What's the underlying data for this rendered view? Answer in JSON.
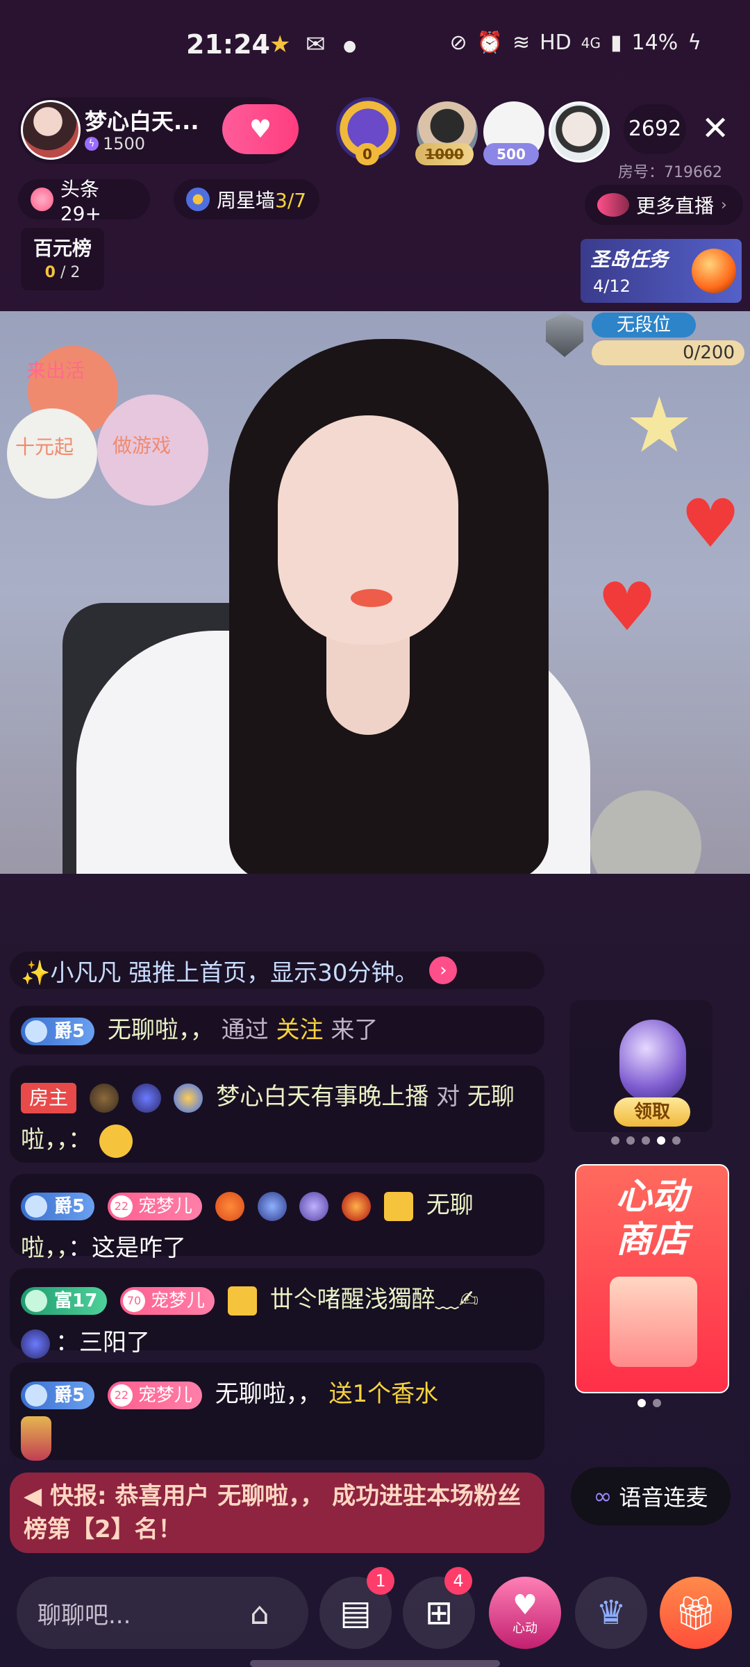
{
  "status_bar": {
    "time": "21:24",
    "network": "HD",
    "signal": "4G",
    "battery": "14%"
  },
  "host": {
    "name": "梦心白天...",
    "count": "1500",
    "follow_icon": "heart-plus"
  },
  "viewers": {
    "badge_1": "0",
    "badge_2": "1000",
    "badge_3": "500",
    "total": "2692",
    "room_id": "房号：719662"
  },
  "top_pills": {
    "headline": "头条29+",
    "weekstar_prefix": "周星墙",
    "weekstar_value": "3/7",
    "more_live": "更多直播"
  },
  "board": {
    "title": "百元榜",
    "current": "0",
    "total": "/ 2"
  },
  "task": {
    "title": "圣岛任务",
    "progress": "4/12"
  },
  "video": {
    "balloon_texts": [
      "来出活",
      "十元起",
      "做游戏"
    ]
  },
  "rank": {
    "label": "无段位",
    "progress": "0/200"
  },
  "pin_bar": {
    "text": "✨小凡凡 强推上首页，显示30分钟。"
  },
  "chat": {
    "m1": {
      "badge": "爵5",
      "user": "无聊啦，，",
      "pre": "通过",
      "action": "关注",
      "post": "来了"
    },
    "m2": {
      "host_badge": "房主",
      "user": "梦心白天有事晚上播",
      "mid": "对",
      "target": "无聊啦，，：",
      "colon": ""
    },
    "m3": {
      "badge": "爵5",
      "pet_lv": "22",
      "pet": "宠梦儿",
      "user": "无聊啦，，",
      "text": "：这是咋了"
    },
    "m4": {
      "badge": "富17",
      "pet_lv": "70",
      "pet": "宠梦儿",
      "user": "丗仒啫醒浅獨醉﹏✍",
      "text": "：三阳了"
    },
    "m5": {
      "badge": "爵5",
      "pet_lv": "22",
      "pet": "宠梦儿",
      "user": "无聊啦，，",
      "gift": "送1个香水"
    }
  },
  "alert": {
    "text": "快报: 恭喜用户 无聊啦，， 成功进驻本场粉丝榜第【2】名！"
  },
  "widgets": {
    "egg_claim": "领取",
    "shop_title_1": "心动",
    "shop_title_2": "商店",
    "voice_link": "语音连麦"
  },
  "bottom_bar": {
    "input_placeholder": "聊聊吧...",
    "msg_count": "1",
    "apps_count": "4",
    "heart_label": "心动"
  }
}
